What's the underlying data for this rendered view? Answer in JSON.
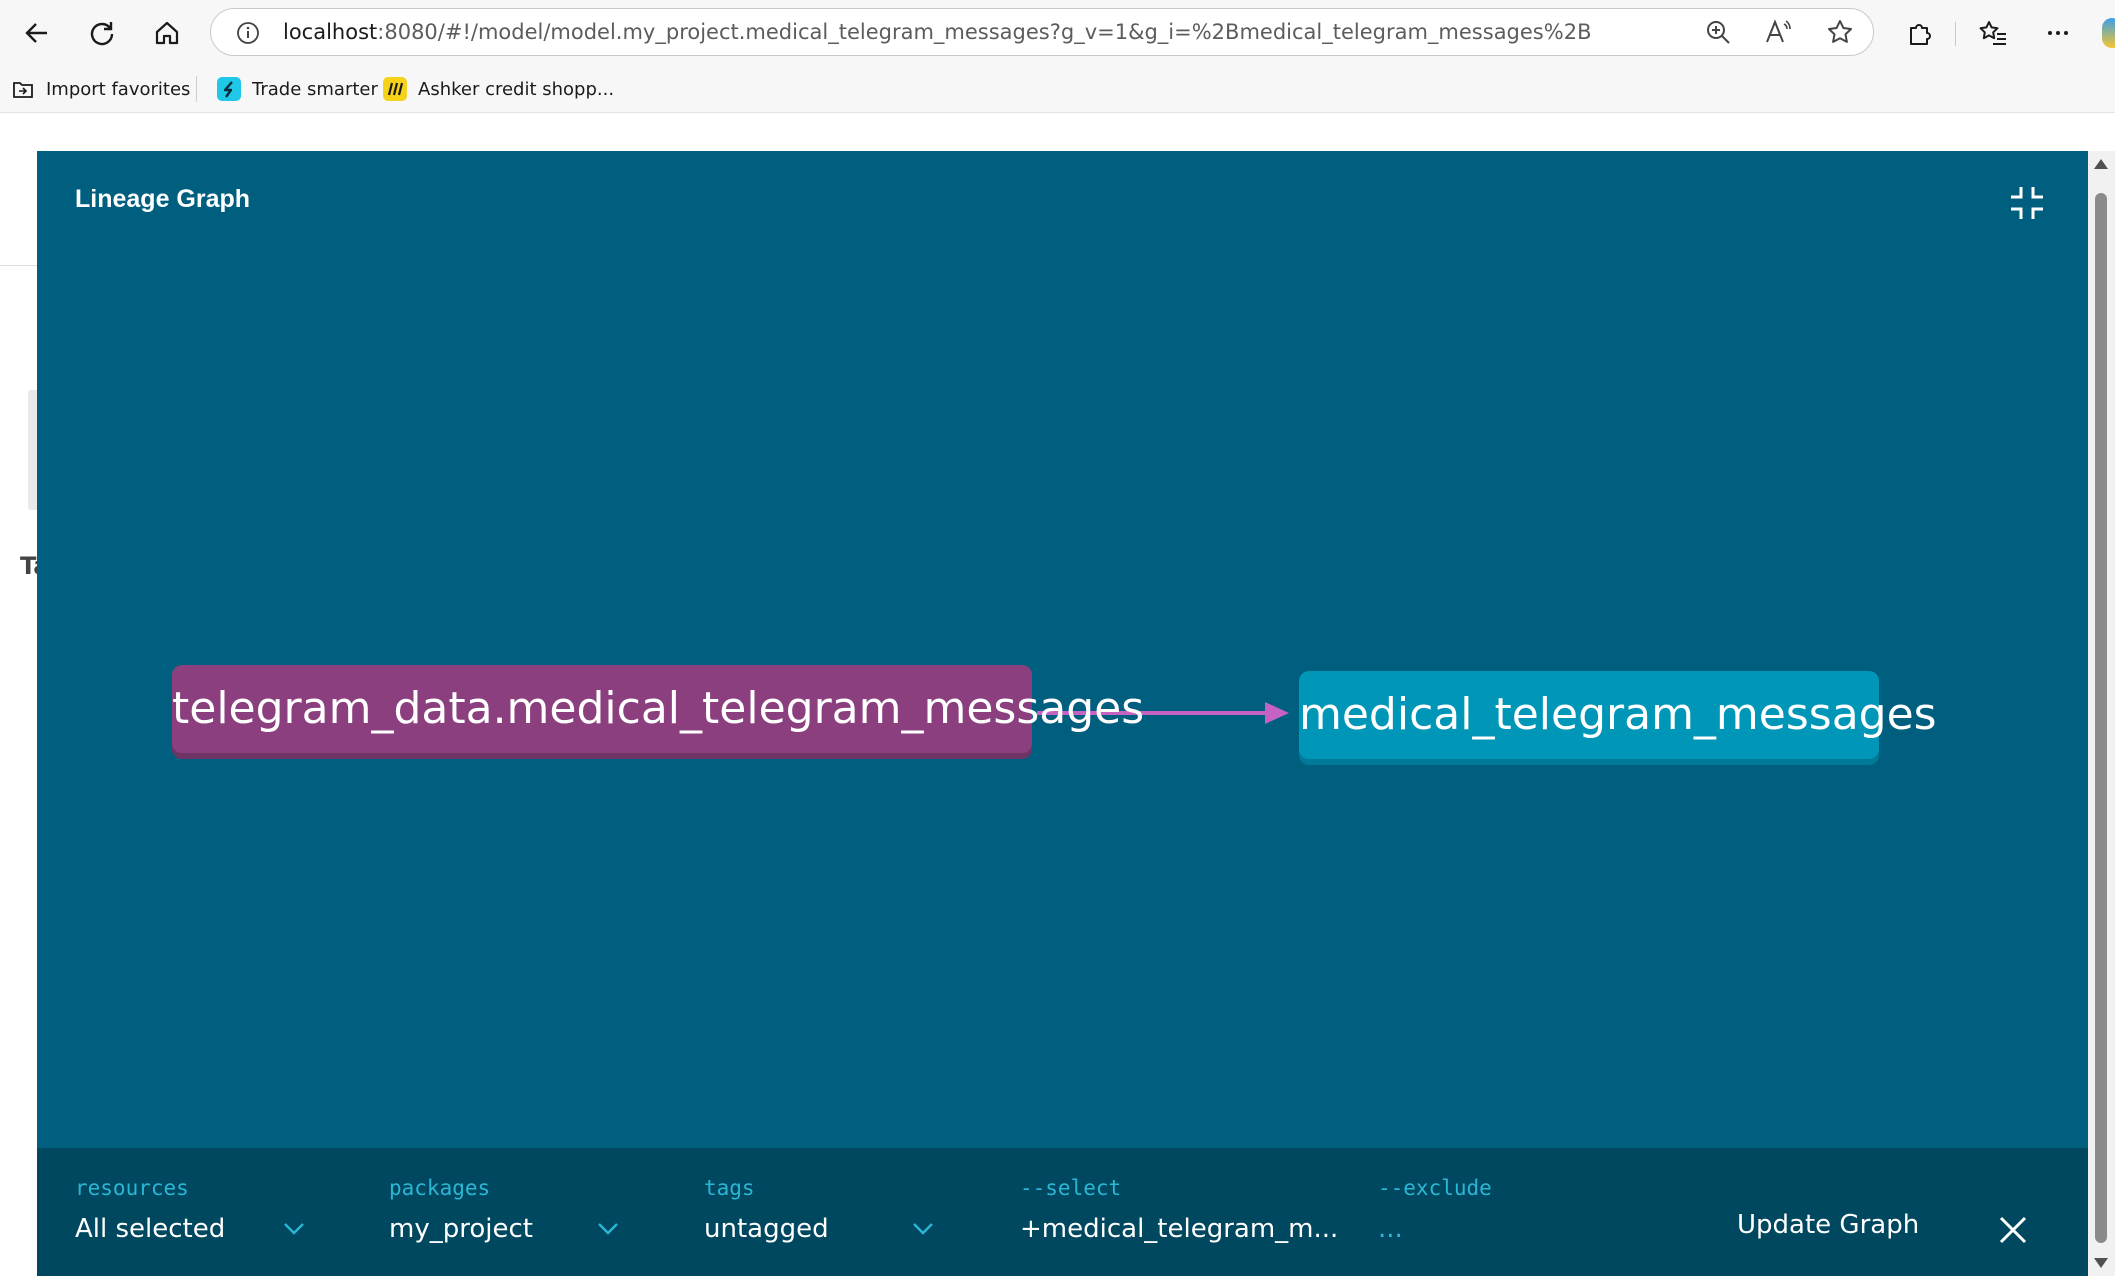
{
  "browser": {
    "url_host": "localhost",
    "url_rest": ":8080/#!/model/model.my_project.medical_telegram_messages?g_v=1&g_i=%2Bmedical_telegram_messages%2B",
    "favorites": [
      {
        "label": "Import favorites",
        "icon": "import-favorites-icon"
      },
      {
        "label": "Trade smarter",
        "icon": "trade-smarter-icon"
      },
      {
        "label": "Ashker credit shopp...",
        "icon": "ashker-icon"
      }
    ]
  },
  "page": {
    "ghost_text": "Ta"
  },
  "modal": {
    "title": "Lineage Graph",
    "nodes": {
      "source": "telegram_data.medical_telegram_messages",
      "model": "medical_telegram_messages"
    },
    "colors": {
      "background": "#005f7f",
      "source_node": "#8b3f7e",
      "model_node": "#0096b8",
      "edge": "#c562c2"
    }
  },
  "filters": {
    "resources": {
      "label": "resources",
      "value": "All selected"
    },
    "packages": {
      "label": "packages",
      "value": "my_project"
    },
    "tags": {
      "label": "tags",
      "value": "untagged"
    },
    "select": {
      "label": "--select",
      "value": "+medical_telegram_m..."
    },
    "exclude": {
      "label": "--exclude",
      "value": "..."
    },
    "update_label": "Update Graph"
  }
}
